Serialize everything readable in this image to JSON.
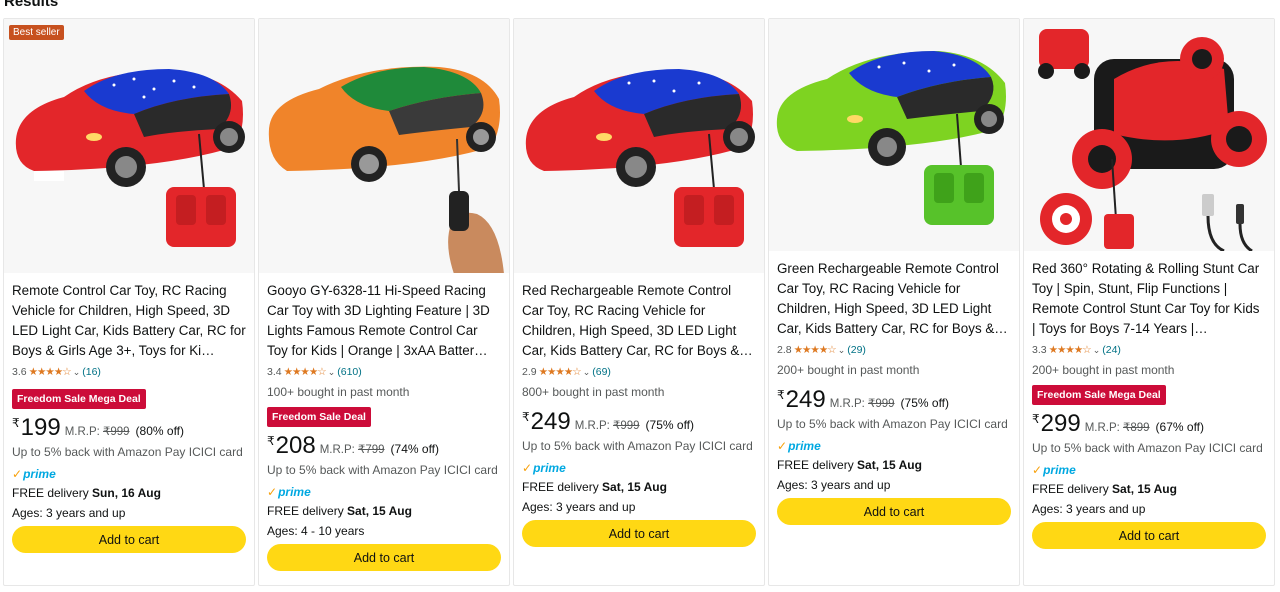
{
  "heading": "Results",
  "products": [
    {
      "badge": "Best seller",
      "title": "Remote Control Car Toy, RC Racing Vehicle for Children, High Speed, 3D LED Light Car, Kids Battery Car, RC for Boys & Girls Age 3+, Toys for Ki…",
      "rating": "3.6",
      "stars": "★★★★☆",
      "rating_count": "(16)",
      "bought": "",
      "deal": "Freedom Sale Mega Deal",
      "rupee": "₹",
      "price": "199",
      "mrp_label": "M.R.P:",
      "mrp": "₹999",
      "off": "(80% off)",
      "cashback": "Up to 5% back with Amazon Pay ICICI card",
      "prime": "prime",
      "delivery_prefix": "FREE delivery ",
      "delivery_date": "Sun, 16 Aug",
      "ages": "Ages: 3 years and up",
      "cart": "Add to cart"
    },
    {
      "badge": "",
      "title": "Gooyo GY-6328-11 Hi-Speed Racing Car Toy with 3D Lighting Feature | 3D Lights Famous Remote Control Car Toy for Kids | Orange | 3xAA Batter…",
      "rating": "3.4",
      "stars": "★★★★☆",
      "rating_count": "(610)",
      "bought": "100+ bought in past month",
      "deal": "Freedom Sale Deal",
      "rupee": "₹",
      "price": "208",
      "mrp_label": "M.R.P:",
      "mrp": "₹799",
      "off": "(74% off)",
      "cashback": "Up to 5% back with Amazon Pay ICICI card",
      "prime": "prime",
      "delivery_prefix": "FREE delivery ",
      "delivery_date": "Sat, 15 Aug",
      "ages": "Ages: 4 - 10 years",
      "cart": "Add to cart"
    },
    {
      "badge": "",
      "title": "Red Rechargeable Remote Control Car Toy, RC Racing Vehicle for Children, High Speed, 3D LED Light Car, Kids Battery Car, RC for Boys &…",
      "rating": "2.9",
      "stars": "★★★★☆",
      "rating_count": "(69)",
      "bought": "800+ bought in past month",
      "deal": "",
      "rupee": "₹",
      "price": "249",
      "mrp_label": "M.R.P:",
      "mrp": "₹999",
      "off": "(75% off)",
      "cashback": "Up to 5% back with Amazon Pay ICICI card",
      "prime": "prime",
      "delivery_prefix": "FREE delivery ",
      "delivery_date": "Sat, 15 Aug",
      "ages": "Ages: 3 years and up",
      "cart": "Add to cart"
    },
    {
      "badge": "",
      "title": "Green Rechargeable Remote Control Car Toy, RC Racing Vehicle for Children, High Speed, 3D LED Light Car, Kids Battery Car, RC for Boys &…",
      "rating": "2.8",
      "stars": "★★★★☆",
      "rating_count": "(29)",
      "bought": "200+ bought in past month",
      "deal": "",
      "rupee": "₹",
      "price": "249",
      "mrp_label": "M.R.P:",
      "mrp": "₹999",
      "off": "(75% off)",
      "cashback": "Up to 5% back with Amazon Pay ICICI card",
      "prime": "prime",
      "delivery_prefix": "FREE delivery ",
      "delivery_date": "Sat, 15 Aug",
      "ages": "Ages: 3 years and up",
      "cart": "Add to cart"
    },
    {
      "badge": "",
      "title": "Red 360° Rotating & Rolling Stunt Car Toy | Spin, Stunt, Flip Functions | Remote Control Stunt Car Toy for Kids | Toys for Boys 7-14 Years |…",
      "rating": "3.3",
      "stars": "★★★★☆",
      "rating_count": "(24)",
      "bought": "200+ bought in past month",
      "deal": "Freedom Sale Mega Deal",
      "rupee": "₹",
      "price": "299",
      "mrp_label": "M.R.P:",
      "mrp": "₹899",
      "off": "(67% off)",
      "cashback": "Up to 5% back with Amazon Pay ICICI card",
      "prime": "prime",
      "delivery_prefix": "FREE delivery ",
      "delivery_date": "Sat, 15 Aug",
      "ages": "Ages: 3 years and up",
      "cart": "Add to cart"
    }
  ],
  "colors": {
    "cart_button": "#ffd814",
    "deal_badge": "#cc0c39",
    "best_seller_badge": "#c7511f",
    "star": "#de7921",
    "prime": "#00a8e1",
    "car_red": "#e3262a",
    "car_orange": "#f0842a",
    "car_green": "#7ed321"
  },
  "icons": {
    "star": "star-icon",
    "prime_check": "prime-check-icon",
    "chevron": "chevron-down-icon"
  }
}
